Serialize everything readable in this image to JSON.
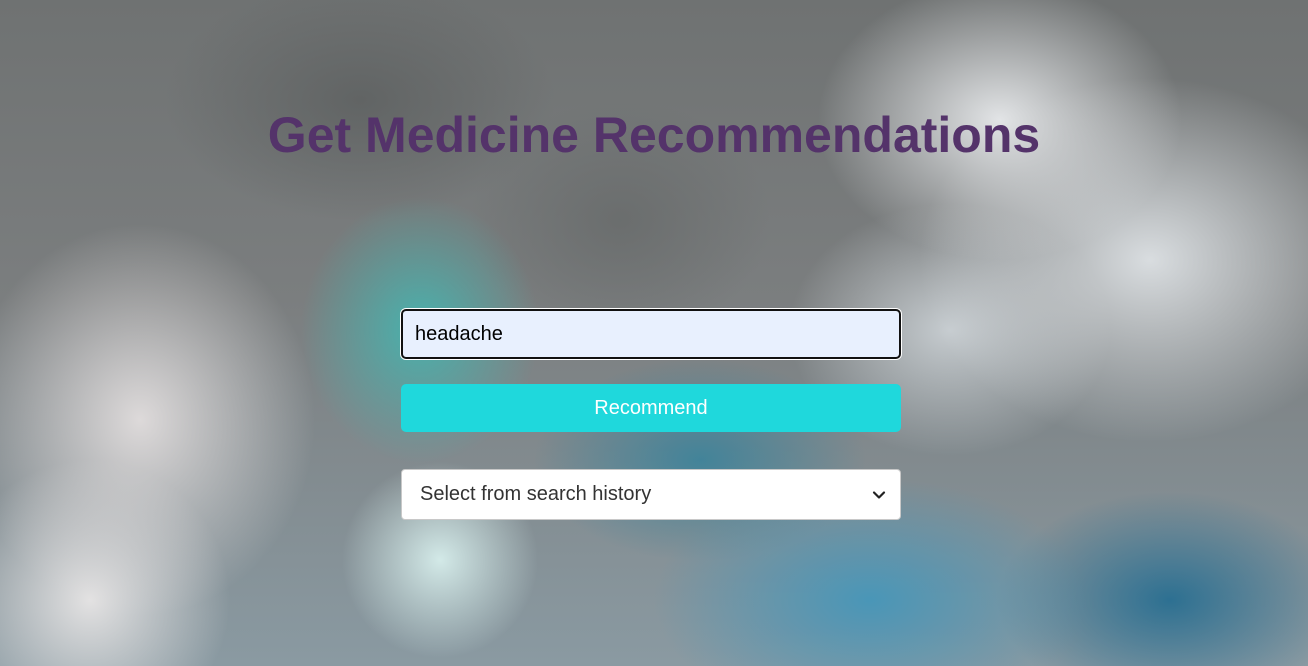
{
  "page": {
    "title": "Get Medicine Recommendations"
  },
  "search": {
    "value": "headache",
    "placeholder": ""
  },
  "recommend_button": {
    "label": "Recommend"
  },
  "history_select": {
    "selected_label": "Select from search history",
    "icon": "chevron-down-icon"
  },
  "colors": {
    "title": "#54336a",
    "button": "#1fd8dc",
    "input_bg": "#e8f0fe"
  }
}
